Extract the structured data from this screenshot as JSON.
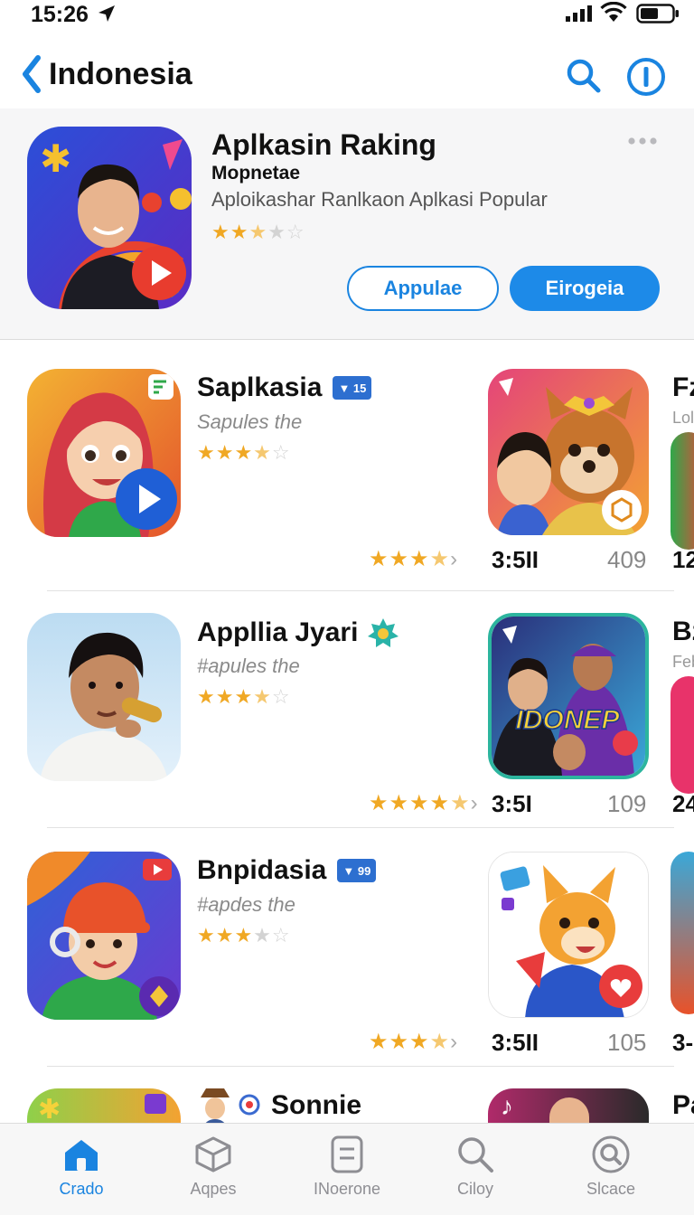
{
  "status": {
    "time": "15:26"
  },
  "nav": {
    "title": "Indonesia"
  },
  "featured": {
    "title": "Aplkasin Raking",
    "subtitle": "Mopnetae",
    "description": "Aploikashar Ranlkaon Aplkasi Popular",
    "rating": 2.5,
    "button_outline": "Appulae",
    "button_filled": "Eirogeia"
  },
  "rows": [
    {
      "name": "Saplkasia",
      "badge": "15",
      "subtitle": "Sapules the",
      "stars": 4,
      "rating_value": "3:5II",
      "count": "409",
      "peek_title": "Fz",
      "peek_sub": "Lol",
      "peek_num": "12"
    },
    {
      "name": "Appllia Jyari",
      "badge": "",
      "subtitle": "#apules the",
      "stars": 3.5,
      "rating_value": "3:5I",
      "count": "109",
      "peek_title": "Bz",
      "peek_sub": "Feb",
      "peek_num": "24"
    },
    {
      "name": "Bnpidasia",
      "badge": "99",
      "subtitle": "#apdes the",
      "stars": 3,
      "rating_value": "3:5II",
      "count": "105",
      "peek_title": "",
      "peek_sub": "",
      "peek_num": "3-"
    }
  ],
  "partial": {
    "name": "Sonnie",
    "peek_title": "Pa"
  },
  "art_text": {
    "row2": "IDONEP"
  },
  "tabs": [
    {
      "label": "Crado",
      "icon": "home-icon",
      "active": true
    },
    {
      "label": "Aqpes",
      "icon": "cube-icon",
      "active": false
    },
    {
      "label": "INoerone",
      "icon": "document-icon",
      "active": false
    },
    {
      "label": "Ciloy",
      "icon": "search-icon",
      "active": false
    },
    {
      "label": "Slcace",
      "icon": "search-circle-icon",
      "active": false
    }
  ],
  "colors": {
    "accent": "#1a84e0",
    "star": "#f0a824",
    "star_empty": "#d3d3d3"
  }
}
